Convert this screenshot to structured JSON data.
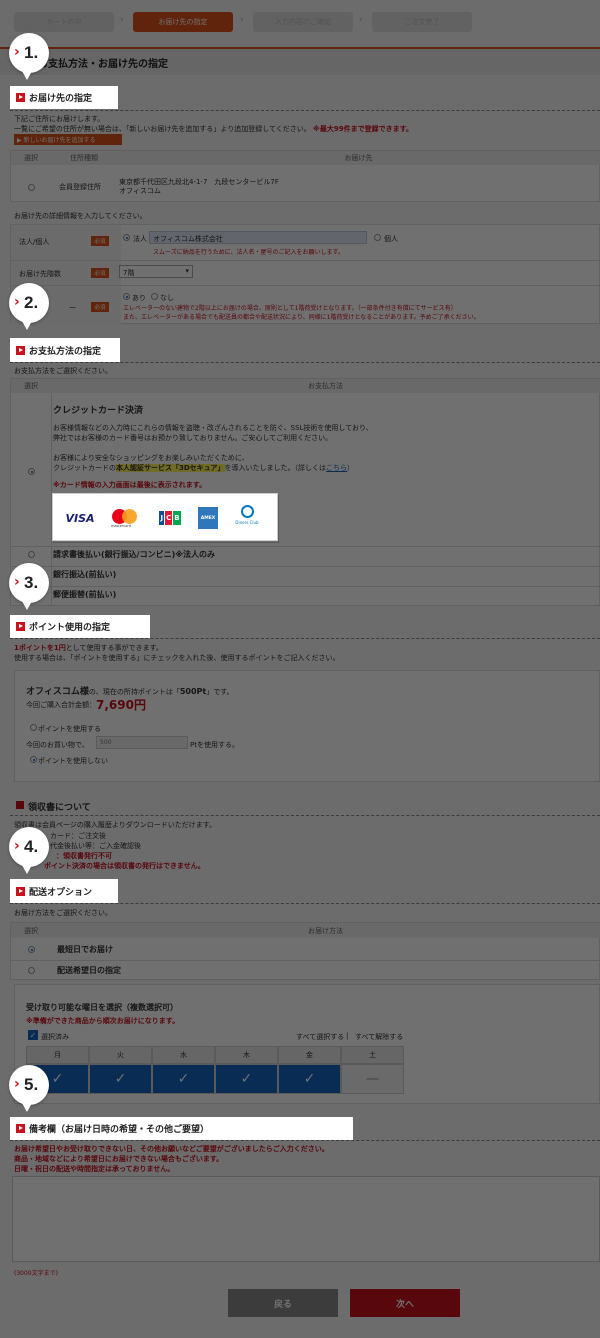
{
  "steps": [
    "カートの中",
    "お届け先の指定",
    "入力内容のご確認",
    "ご注文完了"
  ],
  "page_title": "お支払方法・お届け先の指定",
  "badges": [
    "1.",
    "2.",
    "3.",
    "4.",
    "5."
  ],
  "headings": {
    "delivery": "お届け先の指定",
    "payment": "お支払方法の指定",
    "points": "ポイント使用の指定",
    "receipt": "領収書について",
    "shipping": "配送オプション",
    "remarks": "備考欄（お届け日時の希望・その他ご要望）"
  },
  "delivery": {
    "intro1": "下記ご住所にお届けします。",
    "intro2": "一覧にご希望の住所が無い場合は、「新しいお届け先を追加する」より追加登録してください。",
    "intro2_red": "※最大99件まで登録できます。",
    "add_button": "▶ 新しいお届け先を追加する",
    "table_headers": [
      "選択",
      "住所種類",
      "お届け先"
    ],
    "address_type": "会員登録住所",
    "address_line1": "東京都千代田区九段北4-1-7　九段センタービル7F",
    "address_line2": "オフィスコム",
    "detail_intro": "お届け先の詳細情報を入力してください。",
    "corp_label": "法人/個人",
    "required": "必須",
    "corp_option": "法人",
    "corp_name": "オフィスコム株式会社",
    "personal_option": "個人",
    "corp_note": "スムーズに納品を行うために、法人名・屋号のご記入をお願いします。",
    "floor_label": "お届け先階数",
    "floor_value": "7階",
    "elev_label": "ー",
    "elev_yes": "あり",
    "elev_no": "なし",
    "elev_note1": "エレベーターのない建物で2階以上にお届けの場合、原則として1階荷受けとなります。（一部条件付き有償にてサービス有）",
    "elev_note2": "また、エレベーターがある場合でも配送員の都合や配送状況により、同様に1階荷受けとなることがあります。予めご了承ください。"
  },
  "payment": {
    "intro": "お支払方法をご選択ください。",
    "table_headers": [
      "選択",
      "お支払方法"
    ],
    "credit_title": "クレジットカード決済",
    "credit_text1": "お客様情報などの入力時にこれらの情報を盗聴・改ざんされることを防ぐ、SSL技術を使用しており、",
    "credit_text2": "弊社ではお客様のカード番号はお預かり致しておりません。ご安心してご利用ください。",
    "credit_text3": "お客様により安全なショッピングをお楽しみいただくために、",
    "credit_text4a": "クレジットカードの",
    "credit_text4b": "本人認証サービス「3Dセキュア」",
    "credit_text4c": "を導入いたしました。（詳しくは",
    "credit_link": "こちら",
    "credit_text4d": "）",
    "credit_note": "※カード情報の入力画面は最後に表示されます。",
    "cards": [
      "VISA",
      "mastercard",
      "JCB",
      "AMEX",
      "Diners Club"
    ],
    "option2": "請求書後払い(銀行振込/コンビニ)※法人のみ",
    "option3": "銀行振込(前払い)",
    "option4": "郵便振替(前払い)"
  },
  "points": {
    "intro1a": "1ポイントを1円",
    "intro1b": "として使用する事ができます。",
    "intro2": "使用する場合は、「ポイントを使用する」にチェックを入れた後、使用するポイントをご記入ください。",
    "customer": "オフィスコム様",
    "holding_a": "の、現在の所持ポイントは「",
    "holding_value": "500Pt",
    "holding_b": "」です。",
    "total_label": "今回ご購入合計金額：",
    "total_value": "7,690円",
    "use_option": "ポイントを使用する",
    "use_prefix": "今回のお買い物で、",
    "use_placeholder": "500",
    "use_suffix": "Ptを使用する。",
    "nouse_option": "ポイントを使用しない"
  },
  "receipt": {
    "line1": "領収書は会員ページの購入履歴よりダウンロードいただけます。",
    "line2": "カード：ご注文後",
    "line3": "代金後払い等：ご入金確認後",
    "line4": "：領収書発行不可",
    "line5": "ポイント決済の場合は領収書の発行はできません。"
  },
  "shipping": {
    "intro": "お届け方法をご選択ください。",
    "table_headers": [
      "選択",
      "お届け方法"
    ],
    "option1": "最短日でお届け",
    "option2": "配送希望日の指定",
    "weekday_title": "受け取り可能な曜日を選択（複数選択可）",
    "weekday_note": "※準備ができた商品から順次お届けになります。",
    "selected_label": "選択済み",
    "select_all": "すべて選択する",
    "separator": "|",
    "clear_all": "すべて解除する",
    "days": [
      "月",
      "火",
      "水",
      "木",
      "金",
      "土"
    ],
    "day_marks": [
      "✓",
      "✓",
      "✓",
      "✓",
      "✓",
      "—"
    ]
  },
  "remarks": {
    "note1": "お届け希望日やお受け取りできない日、その他お願いなどご要望がございましたらご入力ください。",
    "note2": "商品・地域などにより希望日にお届けできない場合もございます。",
    "note3": "日曜・祝日の配送や時間指定は承っておりません。",
    "limit": "(3000文字まで)"
  },
  "buttons": {
    "back": "戻る",
    "next": "次へ"
  },
  "colors": {
    "accent": "#d9531a",
    "red": "#c8121e",
    "blue": "#1565c0"
  }
}
